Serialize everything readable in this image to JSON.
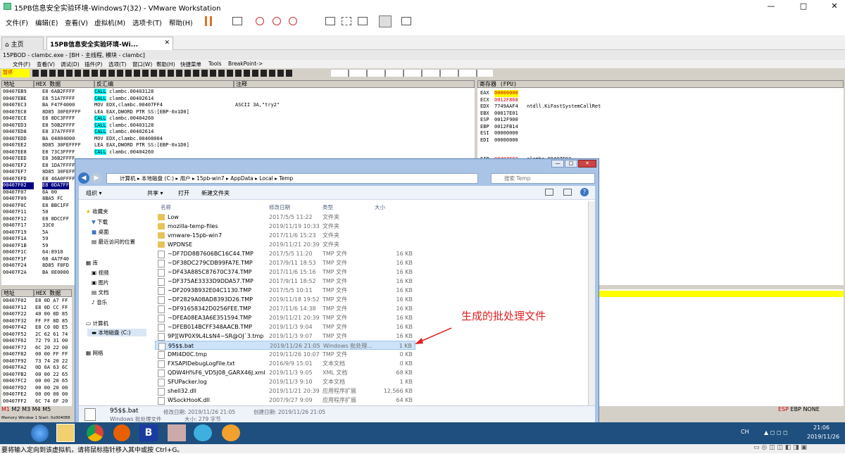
{
  "title": "15PB信息安全实验环境-Windows7(32) - VMware Workstation",
  "menu": [
    "文件(F)",
    "编辑(E)",
    "查看(V)",
    "虚拟机(M)",
    "选项卡(T)",
    "帮助(H)"
  ],
  "tabs": {
    "home": "主页",
    "vm": "15PB信息安全实验环境-Wi..."
  },
  "od": {
    "title": "15PBOD - clambc.exe - [BH - 主线程, 模块 - clambc]",
    "menu": [
      "文件(F)",
      "查看(V)",
      "调试(D)",
      "插件(P)",
      "选项(T)",
      "窗口(W)",
      "帮助(H)",
      "快捷菜单",
      "Tools",
      "BreakPoint->"
    ],
    "status": "暂停",
    "hdr": {
      "addr": "地址",
      "hex": "HEX 数据",
      "dis": "反汇编",
      "cmt": "注释",
      "regs": "寄存器 (FPU)"
    },
    "rows": [
      [
        "00407EB9",
        "E8 6AB2FFFF",
        "CALL clambc.00403128",
        ""
      ],
      [
        "00407EBE",
        "E8 51A7FFFF",
        "CALL clambc.00402614",
        ""
      ],
      [
        "00407EC3",
        "BA F47F4000",
        "MOV EDX,clambc.00407FF4",
        "ASCII 3A,\"try2\""
      ],
      [
        "00407EC8",
        "8D85 30FEFFFF",
        "LEA EAX,DWORD PTR SS:[EBP-0x1D0]",
        ""
      ],
      [
        "00407ECE",
        "E8 8DC3FFFF",
        "CALL clambc.00404260",
        ""
      ],
      [
        "00407ED3",
        "E8 50B2FFFF",
        "CALL clambc.00403128",
        ""
      ],
      [
        "00407ED8",
        "E8 37A7FFFF",
        "CALL clambc.00402614",
        ""
      ],
      [
        "00407EDD",
        "BA 04804000",
        "MOV EDX,clambc.00408004",
        ""
      ],
      [
        "00407EE2",
        "8D85 30FEFFFF",
        "LEA EAX,DWORD PTR SS:[EBP-0x1D0]",
        ""
      ],
      [
        "00407EE8",
        "E8 73C3FFFF",
        "CALL clambc.00404260",
        ""
      ],
      [
        "00407EED",
        "E8 36B2FFFF",
        "",
        ""
      ],
      [
        "00407EF2",
        "E8 1DA7FFFF",
        "",
        ""
      ],
      [
        "00407EF7",
        "8D85 30FEFF",
        "",
        ""
      ],
      [
        "00407EFD",
        "E8 46A0FFFF",
        "",
        ""
      ],
      [
        "00407F02",
        "E8 0DA7FF",
        "",
        ""
      ],
      [
        "00407F07",
        "6A 00",
        "",
        ""
      ],
      [
        "00407F09",
        "8BA5 FC",
        "",
        ""
      ],
      [
        "00407F0C",
        "E8 BBC1FF",
        "",
        ""
      ],
      [
        "00407F11",
        "50",
        "",
        ""
      ],
      [
        "00407F12",
        "E8 8DCCFF",
        "",
        ""
      ],
      [
        "00407F17",
        "33C0",
        "",
        ""
      ],
      [
        "00407F19",
        "5A",
        "",
        ""
      ],
      [
        "00407F1A",
        "59",
        "",
        ""
      ],
      [
        "00407F1B",
        "59",
        "",
        ""
      ],
      [
        "00407F1C",
        "64:8910",
        "",
        ""
      ],
      [
        "00407F1F",
        "68 4A7F40",
        "",
        ""
      ],
      [
        "00407F24",
        "8D85 F8FD",
        "",
        ""
      ],
      [
        "00407F2A",
        "BA 0E0000",
        "",
        ""
      ]
    ],
    "regs": [
      [
        "EAX",
        "00000000",
        ""
      ],
      [
        "ECX",
        "0012F868",
        ""
      ],
      [
        "EDX",
        "7749AAF4",
        "ntdll.KiFastSystemCallRet"
      ],
      [
        "EBX",
        "00017E01",
        ""
      ],
      [
        "ESP",
        "0012F900",
        ""
      ],
      [
        "EBP",
        "0012FB14",
        ""
      ],
      [
        "ESI",
        "00000000",
        ""
      ],
      [
        "EDI",
        "00000000",
        ""
      ],
      [
        "EIP",
        "00407F02",
        "clambc.00407F02"
      ]
    ],
    "dump": [
      [
        "00407F02",
        "E8 0D A7 FF"
      ],
      [
        "00407F12",
        "E8 0D CC FF"
      ],
      [
        "00407F22",
        "40 00 8D 85"
      ],
      [
        "00407F32",
        "FF FF 8D 85"
      ],
      [
        "00407F42",
        "E8 C0 0D E5"
      ],
      [
        "00407F52",
        "2C 62 61 74"
      ],
      [
        "00407F62",
        "72 79 31 00"
      ],
      [
        "00407F72",
        "6C 20 22 00"
      ],
      [
        "00407F82",
        "00 00 FF FF"
      ],
      [
        "00407F92",
        "73 74 20 22"
      ],
      [
        "00407FA2",
        "0D 0A 63 6C"
      ],
      [
        "00407FB2",
        "00 00 22 65"
      ],
      [
        "00407FC2",
        "00 00 20 65"
      ],
      [
        "00407FD2",
        "00 00 20 00"
      ],
      [
        "00407FE2",
        "00 00 00 00"
      ],
      [
        "00407FF2",
        "6C 74 6F 20"
      ]
    ],
    "mem_tabs": [
      "M1",
      "M2",
      "M3",
      "M4",
      "M5"
    ],
    "bottom_right": [
      "ESP",
      "EBP",
      "NONE"
    ],
    "mem_status": "Memory Window 1  Start: 0x0040E8"
  },
  "explorer": {
    "breadcrumb": [
      "计算机",
      "本地磁盘 (C:)",
      "用户",
      "15pb-win7",
      "AppData",
      "Local",
      "Temp"
    ],
    "search_placeholder": "搜索 Temp",
    "toolbar": [
      "组织 ▾",
      "共享 ▾",
      "打开",
      "新建文件夹"
    ],
    "nav": {
      "fav": "收藏夹",
      "download": "下载",
      "desktop": "桌面",
      "recent": "最近访问的位置",
      "lib": "库",
      "video": "视频",
      "pic": "图片",
      "docs": "文档",
      "music": "音乐",
      "computer": "计算机",
      "cdrive": "本地磁盘 (C:)",
      "network": "网络"
    },
    "cols": {
      "name": "名称",
      "date": "修改日期",
      "type": "类型",
      "size": "大小"
    },
    "files": [
      [
        "Low",
        "2017/5/5 11:22",
        "文件夹",
        "",
        "folder"
      ],
      [
        "mozilla-temp-files",
        "2019/11/19 10:33",
        "文件夹",
        "",
        "folder"
      ],
      [
        "vmware-15pb-win7",
        "2017/11/6 15:23",
        "文件夹",
        "",
        "folder"
      ],
      [
        "WPDNSE",
        "2019/11/21 20:39",
        "文件夹",
        "",
        "folder"
      ],
      [
        "~DF7DD8B7606BC16C44.TMP",
        "2017/5/5 11:20",
        "TMP 文件",
        "16 KB",
        "doc"
      ],
      [
        "~DF38DC279CDB99FA7E.TMP",
        "2017/9/11 18:53",
        "TMP 文件",
        "16 KB",
        "doc"
      ],
      [
        "~DF43A885C87670C374.TMP",
        "2017/11/6 15:16",
        "TMP 文件",
        "16 KB",
        "doc"
      ],
      [
        "~DF375AE3333D9DDA57.TMP",
        "2017/9/11 18:52",
        "TMP 文件",
        "16 KB",
        "doc"
      ],
      [
        "~DF2093B932E04C1130.TMP",
        "2017/5/5 10:11",
        "TMP 文件",
        "16 KB",
        "doc"
      ],
      [
        "~DF2829A08AD8393D26.TMP",
        "2019/11/18 19:52",
        "TMP 文件",
        "16 KB",
        "doc"
      ],
      [
        "~DF91658342D0256FEE.TMP",
        "2017/11/6 14:38",
        "TMP 文件",
        "16 KB",
        "doc"
      ],
      [
        "~DFEA08EA3A6E351594.TMP",
        "2019/11/21 20:39",
        "TMP 文件",
        "16 KB",
        "doc"
      ],
      [
        "~DFEB014BCFF348AACB.TMP",
        "2019/11/3 9:04",
        "TMP 文件",
        "16 KB",
        "doc"
      ],
      [
        "9P][WP0X9L4L$N4~SR@OJ`3.tmp",
        "2019/11/3 9:07",
        "TMP 文件",
        "16 KB",
        "doc"
      ],
      [
        "95$$.bat",
        "2019/11/26 21:05",
        "Windows 批处理...",
        "1 KB",
        "doc"
      ],
      [
        "DMI4D0C.tmp",
        "2019/11/26 10:07",
        "TMP 文件",
        "0 KB",
        "doc"
      ],
      [
        "FXSAPIDebugLogFile.txt",
        "2016/9/9 15:01",
        "文本文档",
        "0 KB",
        "doc"
      ],
      [
        "QDW4H%F6_VD5J08_GARX46J.xml",
        "2019/11/3 9:05",
        "XML 文档",
        "68 KB",
        "doc"
      ],
      [
        "SFUPacker.log",
        "2019/11/3 9:10",
        "文本文档",
        "1 KB",
        "doc"
      ],
      [
        "shell32.dll",
        "2019/11/21 20:39",
        "应用程序扩展",
        "12,566 KB",
        "doc"
      ],
      [
        "WSockHooK.dll",
        "2007/9/27 9:09",
        "应用程序扩展",
        "64 KB",
        "doc"
      ]
    ],
    "details": {
      "name": "95$$.bat",
      "type": "Windows 批处理文件",
      "mod": "修改日期: 2019/11/26 21:05",
      "created": "创建日期: 2019/11/26 21:05",
      "size": "大小: 279 字节"
    }
  },
  "annotation": "生成的批处理文件",
  "taskbar": {
    "time": "21:06",
    "date": "2019/11/26",
    "lang": "CH"
  },
  "status_text": "要将输入定向到该虚拟机，请将鼠标指针移入其中或按 Ctrl+G。"
}
